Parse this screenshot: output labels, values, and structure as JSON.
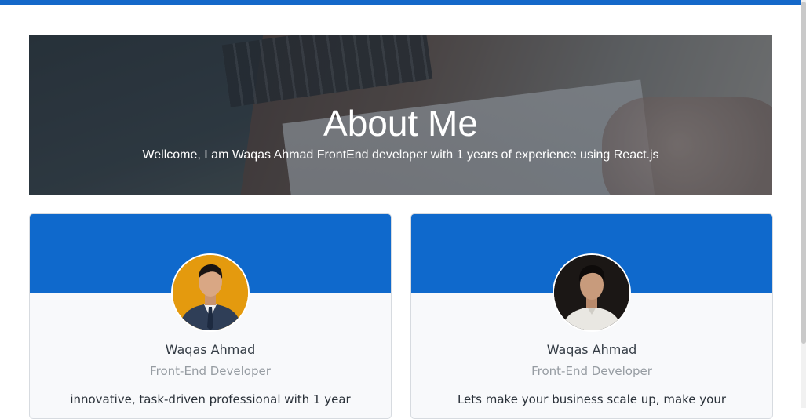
{
  "hero": {
    "title": "About Me",
    "subtitle": "Wellcome, I am Waqas Ahmad FrontEnd developer with 1 years of experience using React.js"
  },
  "cards": [
    {
      "name": "Waqas Ahmad",
      "role": "Front-End Developer",
      "description": "innovative, task-driven professional with 1 year",
      "avatar_bg": "#e49a0e"
    },
    {
      "name": "Waqas Ahmad",
      "role": "Front-End Developer",
      "description": "Lets make your business scale up, make your",
      "avatar_bg": "#1b1715"
    }
  ],
  "colors": {
    "accent": "#0f69cc",
    "topbar": "#1468c9"
  }
}
